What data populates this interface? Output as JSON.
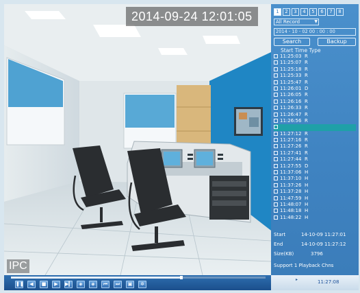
{
  "osd": {
    "timestamp": "2014-09-24 12:01:05",
    "channel_label": "IPC"
  },
  "panel": {
    "channels": [
      "1",
      "2",
      "3",
      "4",
      "5",
      "6",
      "7",
      "8"
    ],
    "record_type": "All Record",
    "datetime": "2014 - 10 - 02   00 : 00 : 00",
    "search_label": "Search",
    "backup_label": "Backup",
    "list_header": "Start Time Type",
    "records": [
      {
        "time": "11:25:03",
        "type": "R"
      },
      {
        "time": "11:25:07",
        "type": "R"
      },
      {
        "time": "11:25:18",
        "type": "R"
      },
      {
        "time": "11:25:33",
        "type": "R"
      },
      {
        "time": "11:25:47",
        "type": "R"
      },
      {
        "time": "11:26:01",
        "type": "D"
      },
      {
        "time": "11:26:05",
        "type": "R"
      },
      {
        "time": "11:26:16",
        "type": "R"
      },
      {
        "time": "11:26:33",
        "type": "R"
      },
      {
        "time": "11:26:47",
        "type": "R"
      },
      {
        "time": "11:26:56",
        "type": "R"
      },
      {
        "time": "",
        "type": "",
        "selected": true
      },
      {
        "time": "11:27:12",
        "type": "R"
      },
      {
        "time": "11:27:16",
        "type": "R"
      },
      {
        "time": "11:27:26",
        "type": "R"
      },
      {
        "time": "11:27:41",
        "type": "R"
      },
      {
        "time": "11:27:44",
        "type": "R"
      },
      {
        "time": "11:27:55",
        "type": "D"
      },
      {
        "time": "11:37:06",
        "type": "H"
      },
      {
        "time": "11:37:10",
        "type": "H"
      },
      {
        "time": "11:37:26",
        "type": "H"
      },
      {
        "time": "11:37:28",
        "type": "H"
      },
      {
        "time": "11:47:59",
        "type": "H"
      },
      {
        "time": "11:48:07",
        "type": "H"
      },
      {
        "time": "11:48:18",
        "type": "H"
      },
      {
        "time": "11:48:22",
        "type": "H"
      }
    ],
    "start_label": "Start",
    "start_value": "14-10-09 11:27:01",
    "end_label": "End",
    "end_value": "14-10-09 11:27:12",
    "size_label": "Size(KB)",
    "size_value": "3796",
    "support_text": "Support 1 Playback Chns"
  },
  "playback": {
    "progress": 0.67,
    "current_time": "11:27:08",
    "controls": [
      "pause",
      "prev",
      "stop",
      "play",
      "next",
      "slow",
      "fast",
      "prev-file",
      "next-file",
      "snapshot",
      "settings"
    ]
  },
  "colors": {
    "panel_bg": "#3f83c1",
    "selected_row": "#1fa0a8",
    "controlbar": "#1b4f8c"
  }
}
